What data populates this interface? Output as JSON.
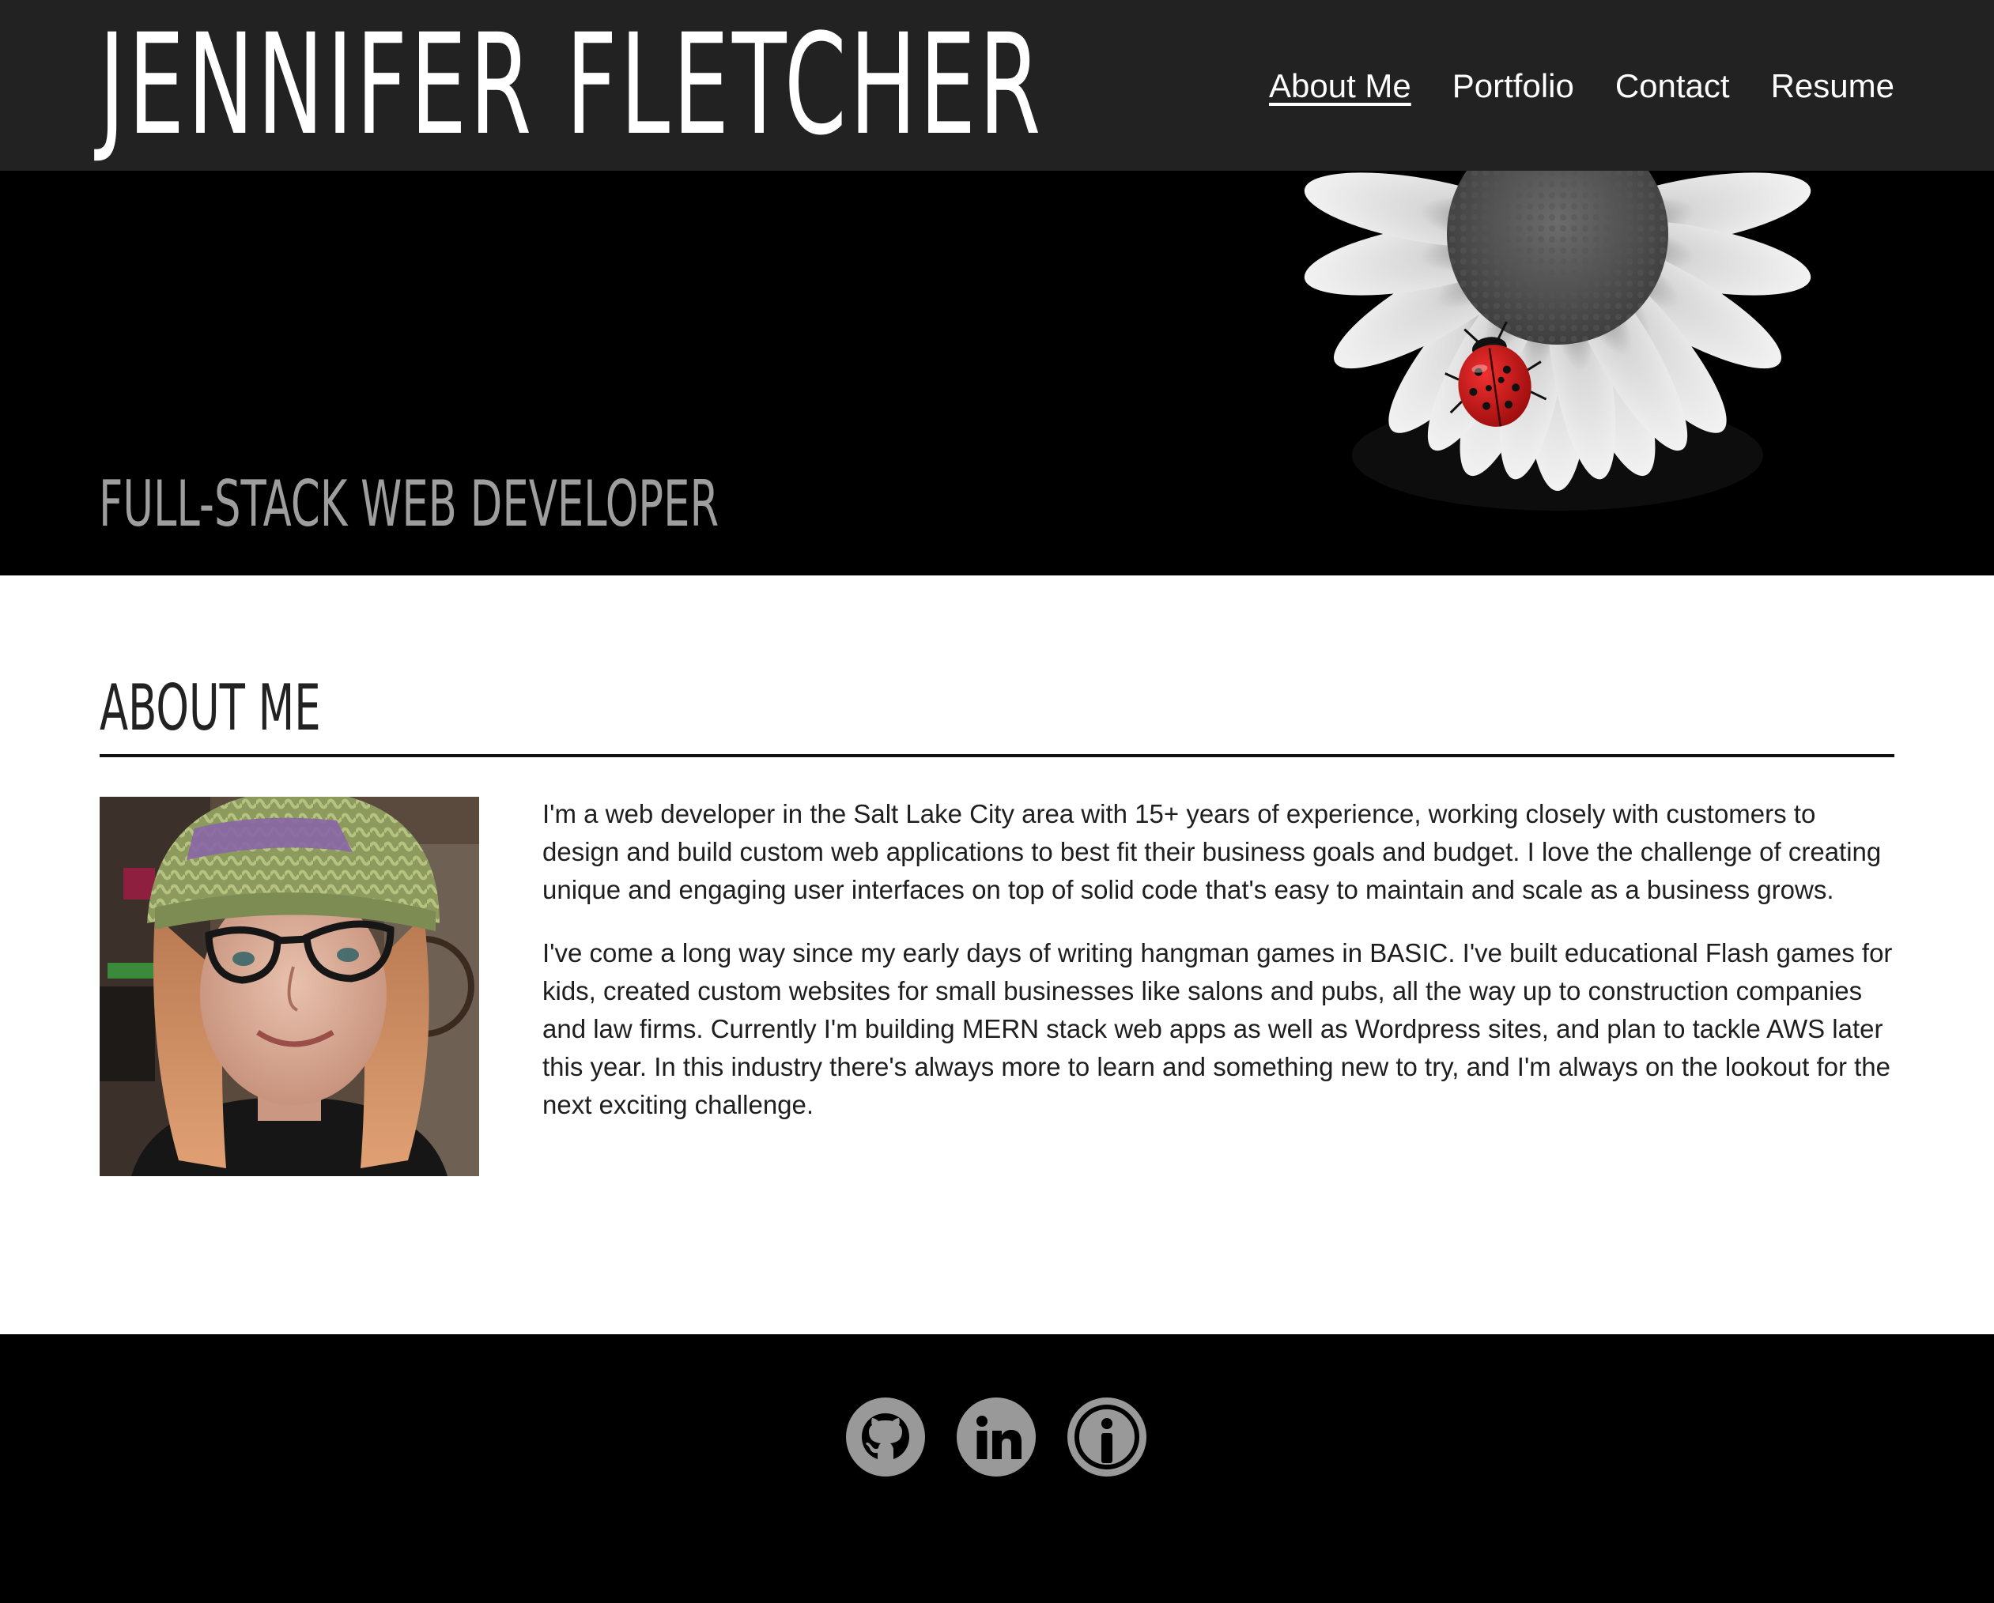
{
  "header": {
    "site_title": "JENNIFER FLETCHER",
    "nav": [
      {
        "label": "About Me",
        "active": true
      },
      {
        "label": "Portfolio",
        "active": false
      },
      {
        "label": "Contact",
        "active": false
      },
      {
        "label": "Resume",
        "active": false
      }
    ]
  },
  "hero": {
    "subtitle": "FULL-STACK WEB DEVELOPER",
    "image_subject": "white daisy with red ladybug"
  },
  "about": {
    "heading": "ABOUT ME",
    "paragraphs": [
      "I'm a web developer in the Salt Lake City area with 15+ years of experience, working closely with customers to design and build custom web applications to best fit their business goals and budget. I love the challenge of creating unique and engaging user interfaces on top of solid code that's easy to maintain and scale as a business grows.",
      "I've come a long way since my early days of writing hangman games in BASIC. I've built educational Flash games for kids, created custom websites for small businesses like salons and pubs, all the way up to construction companies and law firms. Currently I'm building MERN stack web apps as well as Wordpress sites, and plan to tackle AWS later this year. In this industry there's always more to learn and something new to try, and I'm always on the lookout for the next exciting challenge."
    ]
  },
  "footer": {
    "social_icons": [
      "github-icon",
      "linkedin-icon",
      "info-icon"
    ]
  },
  "colors": {
    "header_bg": "#222222",
    "hero_bg": "#000000",
    "footer_bg": "#000000",
    "subtitle": "#9e9e9e",
    "social_icon": "#999999",
    "ladybug": "#d01818"
  }
}
